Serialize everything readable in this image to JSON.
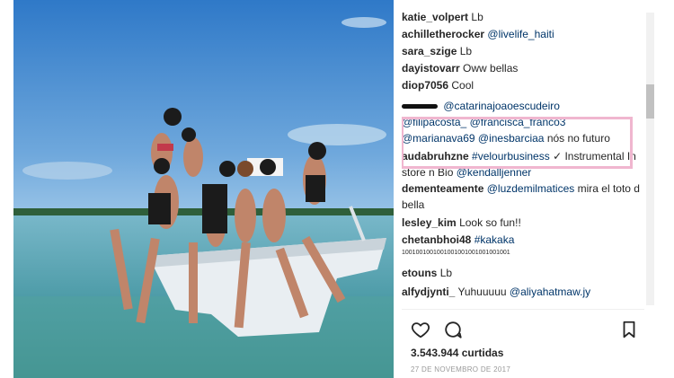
{
  "post": {
    "photo_icon": "beach-boat-photo",
    "comments": [
      {
        "user": "katie_volpert",
        "text": "Lb"
      },
      {
        "user": "achilletherocker",
        "mention": "@livelife_haiti"
      },
      {
        "user": "sara_szige",
        "text": "Lb"
      },
      {
        "user": "dayistovarr",
        "text": "Oww bellas"
      },
      {
        "user": "diop7056",
        "text": "Cool"
      }
    ],
    "highlighted_comment": {
      "mention1": "@catarinajoaoescudeiro",
      "mention2": "@filipacosta_",
      "mention3": "@francisca_franco3",
      "mention4": "@marianava69",
      "mention5": "@inesbarciaa",
      "text": "nós no futuro"
    },
    "comments2": [
      {
        "user": "audabruhzne",
        "mention": "#velourbusiness",
        "text": "✓ Instrumental In store n Bio",
        "mention2": "@kendalljenner"
      },
      {
        "user": "dementeamente",
        "mention": "@luzdemilmatices",
        "text": "mira el toto d bella"
      },
      {
        "user": "lesley_kim",
        "text": "Look so fun!!"
      },
      {
        "user": "chetanbhoi48",
        "mention": "#kakaka",
        "subtext": "1001001001001001001001001001001"
      },
      {
        "user": "etouns",
        "text": "Lb"
      },
      {
        "user": "alfydjynti_",
        "text": "Yuhuuuuu",
        "mention": "@aliyahatmaw.jy"
      }
    ],
    "likes": "3.543.944 curtidas",
    "date": "27 DE NOVEMBRO DE 2017",
    "icons": {
      "like": "heart-icon",
      "comment": "comment-icon",
      "save": "bookmark-icon"
    },
    "highlight_color": "#f0b6cf"
  }
}
